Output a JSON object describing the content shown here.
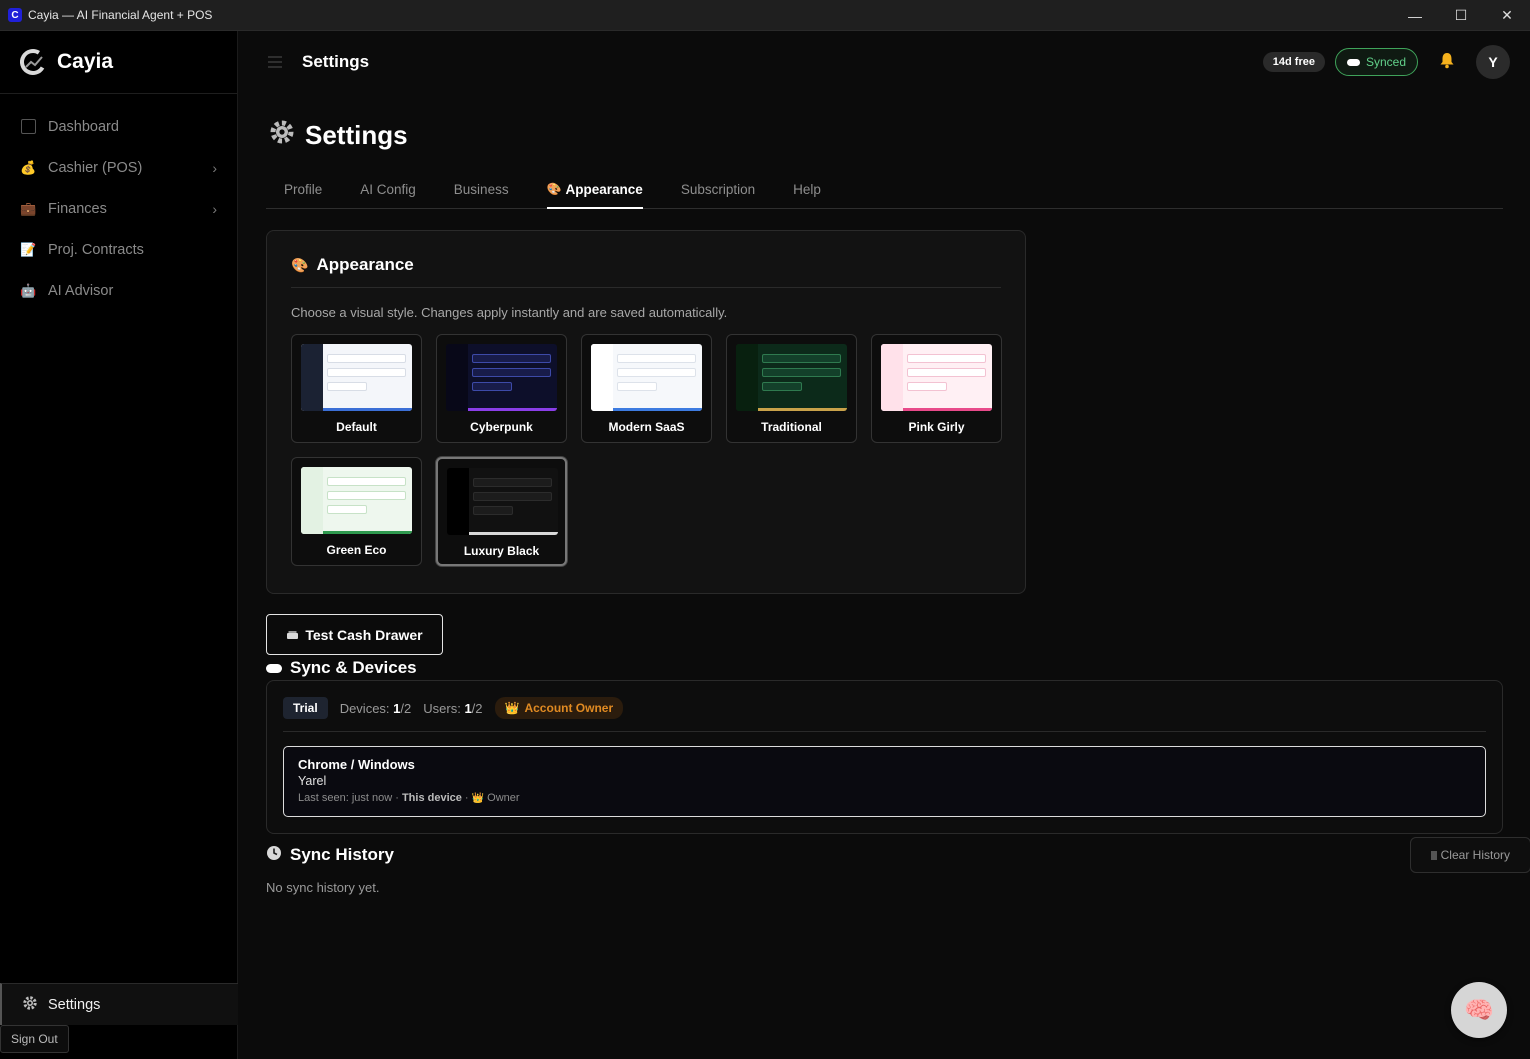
{
  "window": {
    "title": "Cayia — AI Financial Agent + POS",
    "app_icon_letter": "C",
    "controls": {
      "minimize": "—",
      "maximize": "☐",
      "close": "✕"
    }
  },
  "sidebar": {
    "brand": "Cayia",
    "items": [
      {
        "label": "Dashboard",
        "icon": "square-icon"
      },
      {
        "label": "Cashier (POS)",
        "icon": "money-bag-icon",
        "glyph": "💰",
        "chevron": "›"
      },
      {
        "label": "Finances",
        "icon": "briefcase-icon",
        "glyph": "💼",
        "chevron": "›"
      },
      {
        "label": "Proj. Contracts",
        "icon": "memo-icon",
        "glyph": "📝"
      },
      {
        "label": "AI Advisor",
        "icon": "robot-icon",
        "glyph": "🤖"
      }
    ],
    "settings_label": "Settings",
    "signout_label": "Sign Out"
  },
  "header": {
    "title": "Settings",
    "trial_badge": "14d free",
    "synced_badge": "Synced",
    "avatar_initial": "Y"
  },
  "page": {
    "title": "Settings",
    "tabs": [
      "Profile",
      "AI Config",
      "Business",
      "Appearance",
      "Subscription",
      "Help"
    ],
    "active_tab": "Appearance"
  },
  "appearance": {
    "title": "Appearance",
    "description": "Choose a visual style. Changes apply instantly and are saved automatically.",
    "selected": "Luxury Black",
    "themes": [
      {
        "name": "Default",
        "bg": "#f4f6fa",
        "side": "#1b2233",
        "row_bg": "#ffffff",
        "row_border": "#d8dde6",
        "accent": "#3b6fd6"
      },
      {
        "name": "Cyberpunk",
        "bg": "#0d0f2a",
        "side": "#080818",
        "row_bg": "#181c4a",
        "row_border": "#3d4aa8",
        "accent": "#8a3ee8"
      },
      {
        "name": "Modern SaaS",
        "bg": "#f6f8fb",
        "side": "#ffffff",
        "row_bg": "#ffffff",
        "row_border": "#dde2ea",
        "accent": "#3d7be0"
      },
      {
        "name": "Traditional",
        "bg": "#0c2a1a",
        "side": "#08200f",
        "row_bg": "#13402a",
        "row_border": "#2f7a4f",
        "accent": "#c9a24a"
      },
      {
        "name": "Pink Girly",
        "bg": "#fff0f4",
        "side": "#ffe1ea",
        "row_bg": "#ffffff",
        "row_border": "#f3c2d2",
        "accent": "#e84a8a"
      },
      {
        "name": "Green Eco",
        "bg": "#eef7ee",
        "side": "#e3f2e3",
        "row_bg": "#ffffff",
        "row_border": "#c7e2c7",
        "accent": "#2f9a4f"
      },
      {
        "name": "Luxury Black",
        "bg": "#111111",
        "side": "#000000",
        "row_bg": "#1c1c1c",
        "row_border": "#2c2c2c",
        "accent": "#d8d8d8"
      }
    ]
  },
  "cash_drawer_button": "Test Cash Drawer",
  "sync": {
    "title": "Sync & Devices",
    "plan": "Trial",
    "devices_label": "Devices:",
    "devices_used": "1",
    "devices_total": "/2",
    "users_label": "Users:",
    "users_used": "1",
    "users_total": "/2",
    "owner_badge": "Account Owner",
    "device": {
      "name": "Chrome / Windows",
      "user": "Yarel",
      "last_seen": "Last seen: just now · ",
      "this_device": "This device",
      "separator": " · ",
      "role": "Owner"
    }
  },
  "history": {
    "title": "Sync History",
    "clear_label": "Clear History",
    "empty": "No sync history yet."
  },
  "colors": {
    "accent_green": "#62d08a",
    "bell": "#f6b21d",
    "owner": "#e08a22"
  }
}
